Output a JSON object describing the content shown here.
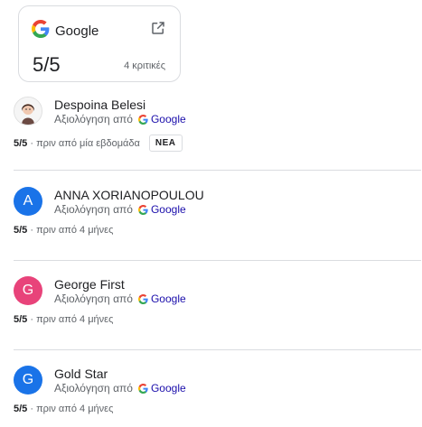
{
  "summary": {
    "brand": "Google",
    "score": "5/5",
    "reviews_count": "4 κριτικές"
  },
  "colors": {
    "avatar_blue": "#1a73e8",
    "avatar_pink": "#e8437a",
    "link": "#1a0dab"
  },
  "reviews": [
    {
      "name": "Despoina Belesi",
      "avatar_letter": "",
      "avatar_type": "photo",
      "source_prefix": "Αξιολόγηση από",
      "source_brand": "Google",
      "score": "5/5",
      "time": "· πριν από μία εβδομάδα",
      "badge": "ΝΕΑ"
    },
    {
      "name": "ANNA XORIANOPOULOU",
      "avatar_letter": "A",
      "avatar_type": "blue",
      "source_prefix": "Αξιολόγηση από",
      "source_brand": "Google",
      "score": "5/5",
      "time": "· πριν από 4 μήνες"
    },
    {
      "name": "George First",
      "avatar_letter": "G",
      "avatar_type": "pink",
      "source_prefix": "Αξιολόγηση από",
      "source_brand": "Google",
      "score": "5/5",
      "time": "· πριν από 4 μήνες"
    },
    {
      "name": "Gold Star",
      "avatar_letter": "G",
      "avatar_type": "blue",
      "source_prefix": "Αξιολόγηση από",
      "source_brand": "Google",
      "score": "5/5",
      "time": "· πριν από 4 μήνες"
    }
  ]
}
